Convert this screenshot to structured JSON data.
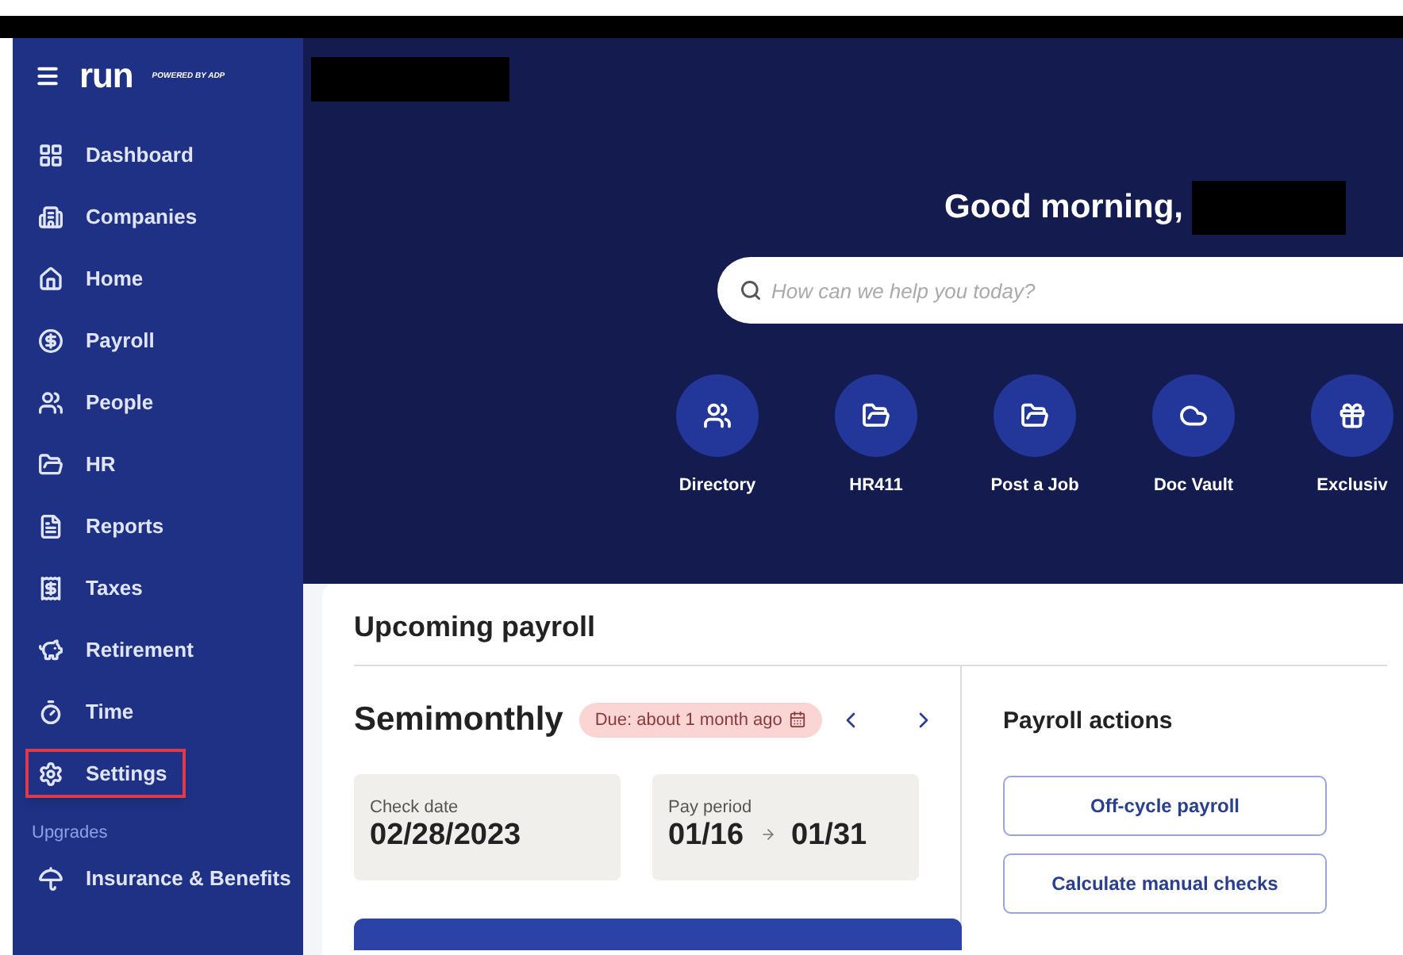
{
  "sidebar": {
    "logo": {
      "wordmark": "run",
      "tagline": "POWERED BY ADP"
    },
    "items": [
      {
        "label": "Dashboard",
        "outlined": false
      },
      {
        "label": "Companies",
        "outlined": false
      },
      {
        "label": "Home",
        "outlined": false
      },
      {
        "label": "Payroll",
        "outlined": false
      },
      {
        "label": "People",
        "outlined": false
      },
      {
        "label": "HR",
        "outlined": false
      },
      {
        "label": "Reports",
        "outlined": false
      },
      {
        "label": "Taxes",
        "outlined": false
      },
      {
        "label": "Retirement",
        "outlined": false
      },
      {
        "label": "Time",
        "outlined": false
      },
      {
        "label": "Settings",
        "outlined": true
      }
    ],
    "section_label": "Upgrades",
    "upgrade_items": [
      {
        "label": "Insurance & Benefits"
      }
    ]
  },
  "hero": {
    "greeting": "Good morning,",
    "search": {
      "placeholder": "How can we help you today?"
    },
    "quick_actions": [
      {
        "label": "Directory"
      },
      {
        "label": "HR411"
      },
      {
        "label": "Post a Job"
      },
      {
        "label": "Doc Vault"
      },
      {
        "label": "Exclusiv"
      }
    ]
  },
  "payroll_card": {
    "title": "Upcoming payroll",
    "frequency": "Semimonthly",
    "due_badge": "Due: about 1 month ago",
    "check_date": {
      "label": "Check date",
      "value": "02/28/2023"
    },
    "pay_period": {
      "label": "Pay period",
      "start": "01/16",
      "end": "01/31"
    },
    "actions_title": "Payroll actions",
    "actions": [
      "Off-cycle payroll",
      "Calculate manual checks"
    ]
  }
}
